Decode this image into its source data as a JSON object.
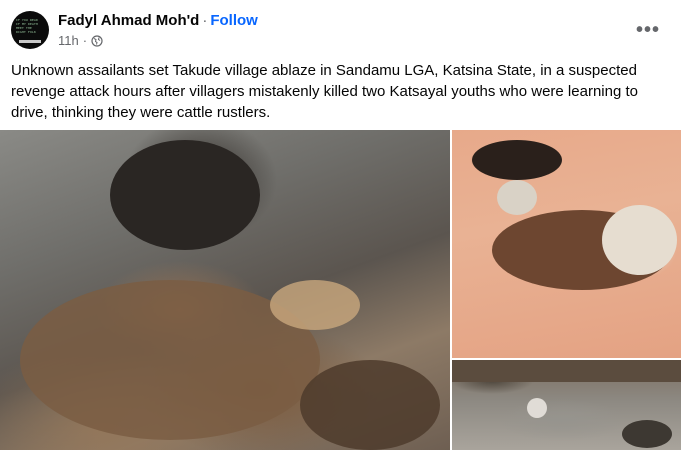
{
  "post": {
    "author": "Fadyl Ahmad Moh'd",
    "separator": "·",
    "follow_label": "Follow",
    "time": "11h",
    "meta_separator": "·",
    "privacy_icon": "globe-icon",
    "more_icon": "more-options-icon",
    "more_label": "•••",
    "text": "Unknown assailants set Takude village ablaze in Sandamu LGA, Katsina State, in a suspected revenge attack hours after villagers mistakenly killed two Katsayal youths who were learning to drive, thinking they were cattle rustlers."
  },
  "avatar": {
    "text": "IF YOU READ IF MY DEATH MEET THE RIGHT FOLK"
  },
  "photos": [
    {
      "description_icon": "photo-burned-cattle"
    },
    {
      "description_icon": "photo-burned-goats"
    },
    {
      "description_icon": "photo-burned-village"
    }
  ],
  "colors": {
    "link": "#0866ff",
    "text": "#050505",
    "secondary": "#65676b"
  }
}
